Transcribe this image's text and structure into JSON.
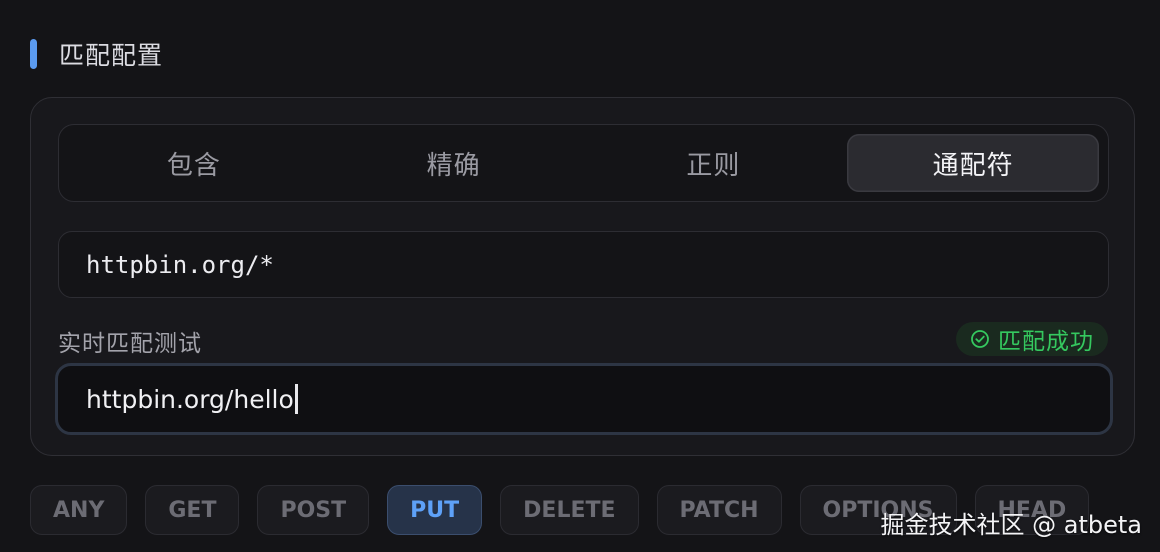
{
  "section": {
    "title": "匹配配置"
  },
  "match_modes": {
    "options": [
      "包含",
      "精确",
      "正则",
      "通配符"
    ],
    "selected": "通配符"
  },
  "pattern": {
    "value": "httpbin.org/*"
  },
  "test": {
    "label": "实时匹配测试",
    "status": "匹配成功",
    "status_icon": "check-circle-icon",
    "status_color": "#35c85f",
    "value": "httpbin.org/hello"
  },
  "methods": {
    "items": [
      "ANY",
      "GET",
      "POST",
      "PUT",
      "DELETE",
      "PATCH",
      "OPTIONS",
      "HEAD"
    ],
    "selected": "PUT"
  },
  "watermark": {
    "text": "掘金技术社区 @ atbeta"
  },
  "colors": {
    "accent": "#5b9bf0",
    "active_method": "#5ea1f7",
    "success": "#35c85f"
  }
}
